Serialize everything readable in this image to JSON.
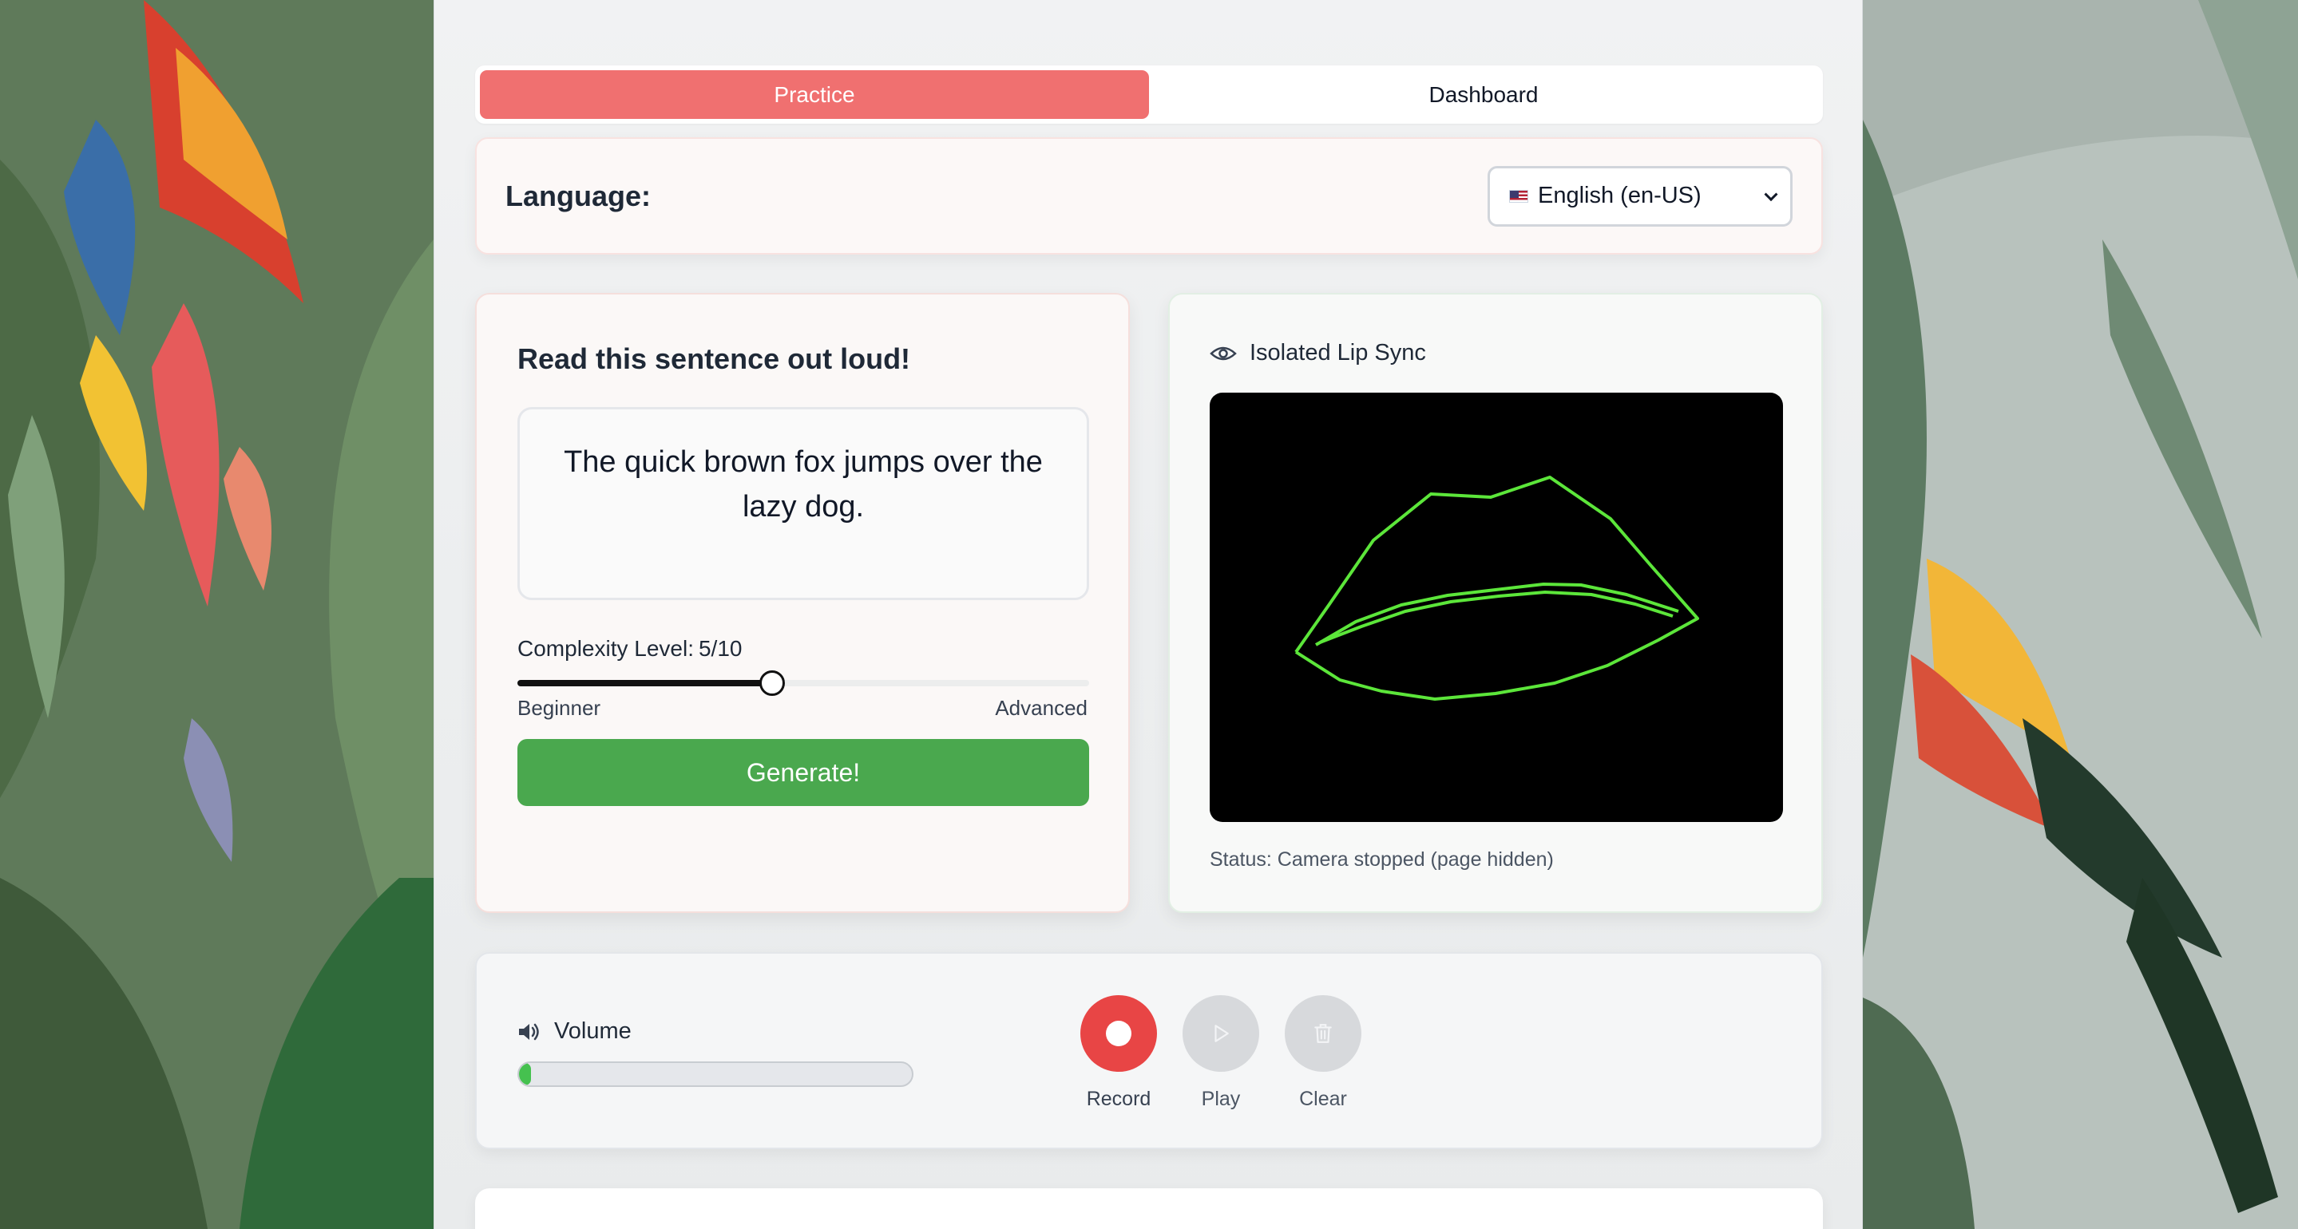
{
  "nav": {
    "tabs": [
      {
        "label": "Practice",
        "active": true
      },
      {
        "label": "Dashboard",
        "active": false
      }
    ]
  },
  "language": {
    "label": "Language:",
    "selected": "English (en-US)",
    "flag_icon": "us-flag-icon"
  },
  "practice": {
    "heading": "Read this sentence out loud!",
    "sentence": "The quick brown fox jumps over the lazy dog.",
    "complexity_label": "Complexity Level:",
    "complexity_value": "5/10",
    "complexity_level": 5,
    "complexity_max": 10,
    "min_label": "Beginner",
    "max_label": "Advanced",
    "generate_label": "Generate!",
    "generate_color": "#4aa84e"
  },
  "lipsync": {
    "title": "Isolated Lip Sync",
    "title_icon": "eye-icon",
    "status": "Status: Camera stopped (page hidden)",
    "outline_color": "#5ce63a"
  },
  "audio": {
    "volume_label": "Volume",
    "volume_icon": "speaker-icon",
    "volume_level": 0.03,
    "record_label": "Record",
    "play_label": "Play",
    "clear_label": "Clear",
    "record_color": "#e84545"
  },
  "colors": {
    "accent": "#f07070",
    "meter": "#45c14f"
  }
}
